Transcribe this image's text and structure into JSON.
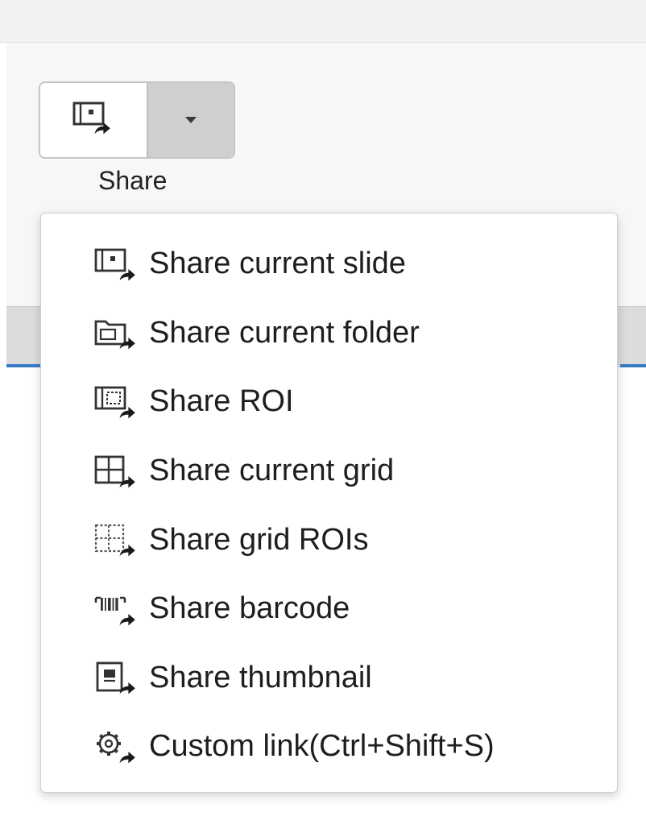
{
  "share_button": {
    "label": "Share",
    "icon": "share-slide-icon",
    "dropdown_icon": "caret-down-icon"
  },
  "menu": {
    "items": [
      {
        "label": "Share current slide",
        "icon": "share-slide-icon"
      },
      {
        "label": "Share current folder",
        "icon": "share-folder-icon"
      },
      {
        "label": "Share ROI",
        "icon": "share-roi-icon"
      },
      {
        "label": "Share current grid",
        "icon": "share-grid-icon"
      },
      {
        "label": "Share grid ROIs",
        "icon": "share-grid-rois-icon"
      },
      {
        "label": "Share barcode",
        "icon": "share-barcode-icon"
      },
      {
        "label": "Share thumbnail",
        "icon": "share-thumbnail-icon"
      },
      {
        "label": "Custom link(Ctrl+Shift+S)",
        "icon": "custom-link-gear-icon"
      }
    ]
  },
  "colors": {
    "accent": "#3a7bc8",
    "dropdown_bg": "#cfcfcf"
  }
}
